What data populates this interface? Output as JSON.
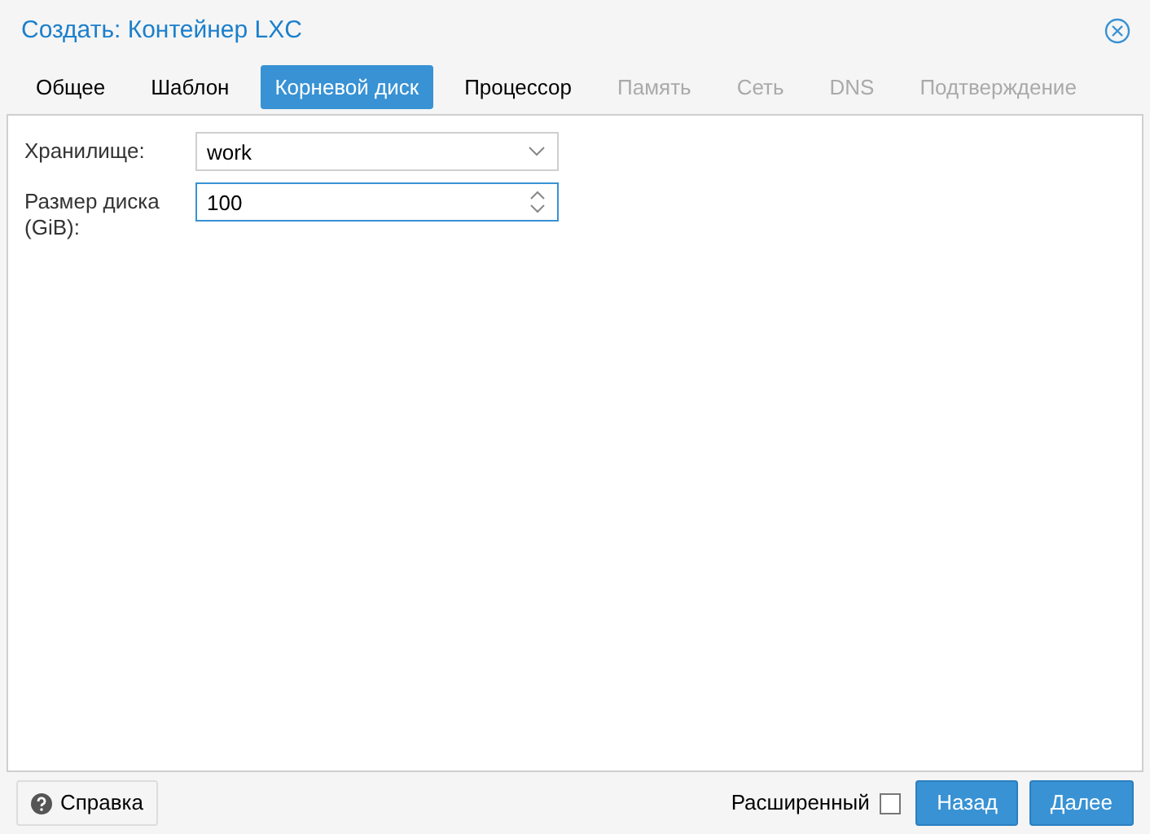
{
  "window": {
    "title": "Создать: Контейнер LXC"
  },
  "tabs": [
    {
      "label": "Общее",
      "selected": false,
      "disabled": false
    },
    {
      "label": "Шаблон",
      "selected": false,
      "disabled": false
    },
    {
      "label": "Корневой диск",
      "selected": true,
      "disabled": false
    },
    {
      "label": "Процессор",
      "selected": false,
      "disabled": false
    },
    {
      "label": "Память",
      "selected": false,
      "disabled": true
    },
    {
      "label": "Сеть",
      "selected": false,
      "disabled": true
    },
    {
      "label": "DNS",
      "selected": false,
      "disabled": true
    },
    {
      "label": "Подтверждение",
      "selected": false,
      "disabled": true
    }
  ],
  "fields": [
    {
      "kind": "select",
      "label": "Хранилище:",
      "value": "work",
      "focused": false
    },
    {
      "kind": "spinner",
      "label": "Размер диска (GiB):",
      "value": "100",
      "focused": true
    }
  ],
  "footer": {
    "help": "Справка",
    "advanced": {
      "label": "Расширенный",
      "checked": false
    },
    "buttons": [
      "Назад",
      "Далее"
    ]
  }
}
